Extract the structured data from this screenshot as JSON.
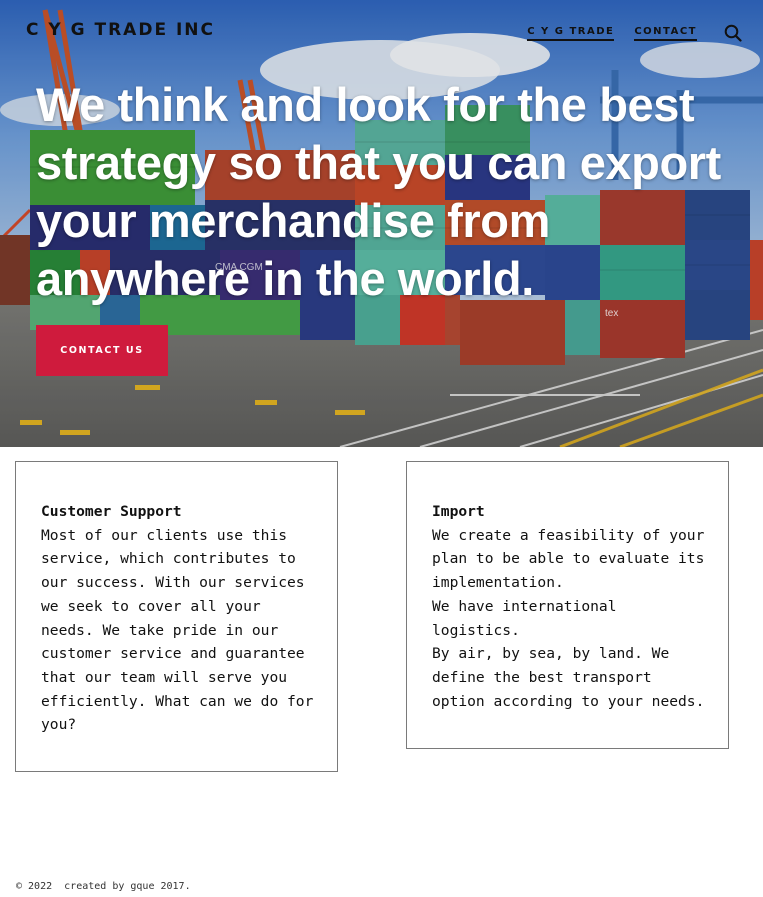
{
  "header": {
    "brand": "C Y G TRADE INC",
    "nav": [
      {
        "label": "C Y G TRADE"
      },
      {
        "label": "CONTACT"
      }
    ],
    "search_icon": "search-icon"
  },
  "hero": {
    "headline_lines": [
      "We think and look for the best",
      "strategy so that you can export",
      "your merchandise from",
      "anywhere in the world."
    ],
    "cta_label": "CONTACT US",
    "background_image": "shipping-containers-port-photo",
    "container_labels": [
      "CMA CGM",
      "tex"
    ]
  },
  "cards": [
    {
      "title": "Customer Support",
      "lines": [
        "Most of our clients use this",
        "service, which contributes to",
        "our success. With our services",
        "we seek to cover all your",
        "needs. We take pride in our",
        "customer service and guarantee",
        "that our team will serve you",
        "efficiently. What can we do for",
        "you?"
      ]
    },
    {
      "title": "Import",
      "lines": [
        "We create a feasibility of your",
        "plan to be able to evaluate its",
        "implementation.",
        "We have international",
        "logistics.",
        "By air, by sea, by land. We",
        "define the best transport",
        "option according to your needs."
      ]
    }
  ],
  "footer": {
    "text": "© 2022  created by gque 2017."
  },
  "colors": {
    "cta_background": "#cf1b3d",
    "text_dark": "#111111",
    "card_border": "#7a7a7a"
  }
}
